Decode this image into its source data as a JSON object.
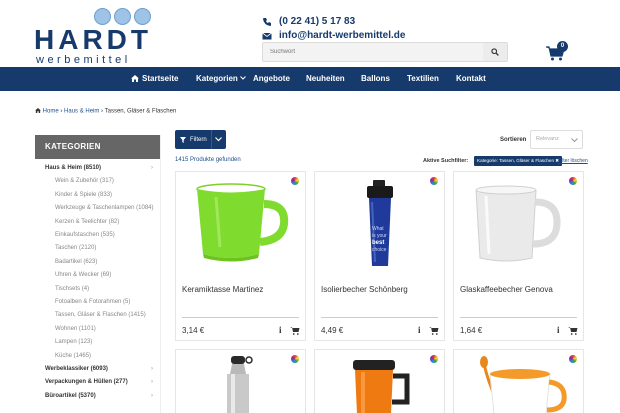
{
  "brand": {
    "name": "HARDT",
    "tagline": "werbemittel"
  },
  "contact": {
    "phone": "(0 22 41) 5 17 83",
    "email": "info@hardt-werbemittel.de"
  },
  "search": {
    "placeholder": "Suchwort"
  },
  "cart": {
    "count": "0"
  },
  "nav": {
    "items": [
      {
        "label": "Startseite",
        "icon": "home-icon"
      },
      {
        "label": "Kategorien",
        "icon": "chevron-down-icon"
      },
      {
        "label": "Angebote"
      },
      {
        "label": "Neuheiten"
      },
      {
        "label": "Ballons"
      },
      {
        "label": "Textilien"
      },
      {
        "label": "Kontakt"
      }
    ]
  },
  "breadcrumb": {
    "items": [
      "Home",
      "Haus & Heim",
      "Tassen, Gläser & Flaschen"
    ]
  },
  "sidebar": {
    "title": "KATEGORIEN",
    "categories": [
      {
        "label": "Haus & Heim (8510)",
        "level": "main",
        "expandable": true
      },
      {
        "label": "Wein & Zubehör (317)",
        "level": "sub"
      },
      {
        "label": "Kinder & Spiele (833)",
        "level": "sub"
      },
      {
        "label": "Werkzeuge & Taschenlampen (1084)",
        "level": "sub"
      },
      {
        "label": "Kerzen & Teelichter (82)",
        "level": "sub"
      },
      {
        "label": "Einkaufstaschen (535)",
        "level": "sub"
      },
      {
        "label": "Taschen (2120)",
        "level": "sub"
      },
      {
        "label": "Badartikel (623)",
        "level": "sub"
      },
      {
        "label": "Uhren & Wecker (69)",
        "level": "sub"
      },
      {
        "label": "Tischsets (4)",
        "level": "sub"
      },
      {
        "label": "Fotoalben & Fotorahmen (5)",
        "level": "sub"
      },
      {
        "label": "Tassen, Gläser & Flaschen (1415)",
        "level": "sub"
      },
      {
        "label": "Wohnen (1101)",
        "level": "sub"
      },
      {
        "label": "Lampen (123)",
        "level": "sub"
      },
      {
        "label": "Küche (1465)",
        "level": "sub"
      },
      {
        "label": "Werbeklassiker (6093)",
        "level": "main",
        "expandable": true
      },
      {
        "label": "Verpackungen & Hüllen (277)",
        "level": "main",
        "expandable": true
      },
      {
        "label": "Büroartikel (5370)",
        "level": "main",
        "expandable": true
      }
    ]
  },
  "toolbar": {
    "filter_label": "Filtern",
    "product_count": "1415 Produkte gefunden",
    "sort_label": "Sortieren",
    "sort_value": "Relevanz",
    "active_filter_label": "Aktive Suchfilter:",
    "active_filter_chip": "Kategorie: Tassen, Gläser & Flaschen ✖",
    "clear_label": "Filter löschen"
  },
  "products": [
    {
      "name": "Keramiktasse Martinez",
      "price": "3,14 €"
    },
    {
      "name": "Isolierbecher Schönberg",
      "price": "4,49 €"
    },
    {
      "name": "Glaskaffeebecher Genova",
      "price": "1,64 €"
    },
    {
      "name": "",
      "price": ""
    },
    {
      "name": "",
      "price": ""
    },
    {
      "name": "",
      "price": ""
    }
  ],
  "colors": {
    "brand_blue": "#163a6c",
    "link_blue": "#1d4f8c",
    "sidebar_header": "#666666"
  }
}
